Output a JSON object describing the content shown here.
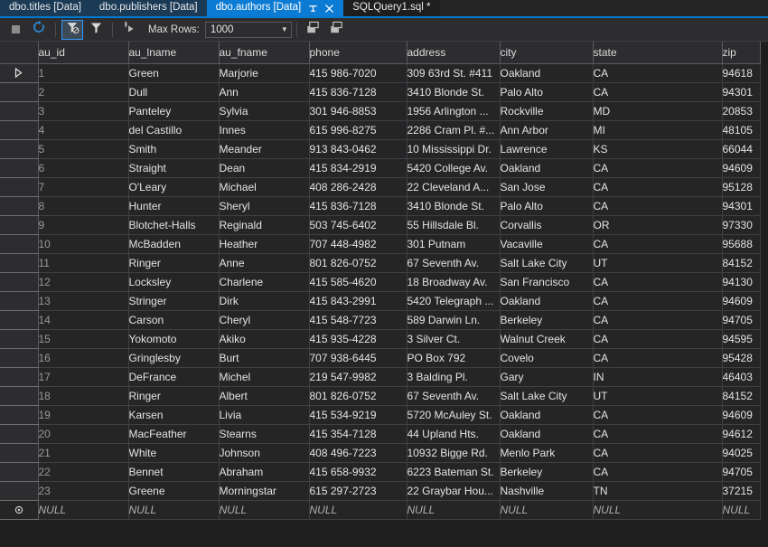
{
  "tabs": [
    {
      "label": "dbo.titles [Data]",
      "active": false,
      "style": "inactive"
    },
    {
      "label": "dbo.publishers [Data]",
      "active": false,
      "style": "inactive"
    },
    {
      "label": "dbo.authors [Data]",
      "active": true,
      "style": "active"
    },
    {
      "label": "SQLQuery1.sql *",
      "active": false,
      "style": "plain"
    }
  ],
  "tab_icons": {
    "pin": "pin-icon",
    "close": "close-icon"
  },
  "toolbar": {
    "stop": "stop-icon",
    "refresh": "refresh-icon",
    "filter_off": "filter-cancel-icon",
    "filter": "filter-icon",
    "sort": "sort-script-icon",
    "max_rows_label": "Max Rows:",
    "max_rows_value": "1000",
    "dropdown_arrow": "chevron-down-icon",
    "show_sql_pane": "show-sql-pane-icon",
    "show_results_pane": "show-results-pane-icon"
  },
  "colors": {
    "accent": "#0c7bd4",
    "tab_inactive": "#1b3a56",
    "toolbar_bg": "#2d2d30",
    "grid_bg": "#252526",
    "grid_line": "#3f3f46",
    "header_line": "#5b5b5e",
    "null_text": "#b0b0b0",
    "selected_border": "#3399ff"
  },
  "grid": {
    "columns": [
      "au_id",
      "au_lname",
      "au_fname",
      "phone",
      "address",
      "city",
      "state",
      "zip"
    ],
    "current_row_index": 0,
    "null_label": "NULL",
    "rows": [
      [
        "1",
        "Green",
        "Marjorie",
        "415 986-7020",
        "309 63rd St. #411",
        "Oakland",
        "CA",
        "94618"
      ],
      [
        "2",
        "Dull",
        "Ann",
        "415 836-7128",
        "3410 Blonde St.",
        "Palo Alto",
        "CA",
        "94301"
      ],
      [
        "3",
        "Panteley",
        "Sylvia",
        "301 946-8853",
        "1956 Arlington ...",
        "Rockville",
        "MD",
        "20853"
      ],
      [
        "4",
        "del Castillo",
        "Innes",
        "615 996-8275",
        "2286 Cram Pl. #...",
        "Ann Arbor",
        "MI",
        "48105"
      ],
      [
        "5",
        "Smith",
        "Meander",
        "913 843-0462",
        "10 Mississippi Dr.",
        "Lawrence",
        "KS",
        "66044"
      ],
      [
        "6",
        "Straight",
        "Dean",
        "415 834-2919",
        "5420 College Av.",
        "Oakland",
        "CA",
        "94609"
      ],
      [
        "7",
        "O'Leary",
        "Michael",
        "408 286-2428",
        "22 Cleveland A...",
        "San Jose",
        "CA",
        "95128"
      ],
      [
        "8",
        "Hunter",
        "Sheryl",
        "415 836-7128",
        "3410 Blonde St.",
        "Palo Alto",
        "CA",
        "94301"
      ],
      [
        "9",
        "Blotchet-Halls",
        "Reginald",
        "503 745-6402",
        "55 Hillsdale Bl.",
        "Corvallis",
        "OR",
        "97330"
      ],
      [
        "10",
        "McBadden",
        "Heather",
        "707 448-4982",
        "301 Putnam",
        "Vacaville",
        "CA",
        "95688"
      ],
      [
        "11",
        "Ringer",
        "Anne",
        "801 826-0752",
        "67 Seventh Av.",
        "Salt Lake City",
        "UT",
        "84152"
      ],
      [
        "12",
        "Locksley",
        "Charlene",
        "415 585-4620",
        "18 Broadway Av.",
        "San Francisco",
        "CA",
        "94130"
      ],
      [
        "13",
        "Stringer",
        "Dirk",
        "415 843-2991",
        "5420 Telegraph ...",
        "Oakland",
        "CA",
        "94609"
      ],
      [
        "14",
        "Carson",
        "Cheryl",
        "415 548-7723",
        "589 Darwin Ln.",
        "Berkeley",
        "CA",
        "94705"
      ],
      [
        "15",
        "Yokomoto",
        "Akiko",
        "415 935-4228",
        "3 Silver Ct.",
        "Walnut Creek",
        "CA",
        "94595"
      ],
      [
        "16",
        "Gringlesby",
        "Burt",
        "707 938-6445",
        "PO Box 792",
        "Covelo",
        "CA",
        "95428"
      ],
      [
        "17",
        "DeFrance",
        "Michel",
        "219 547-9982",
        "3 Balding Pl.",
        "Gary",
        "IN",
        "46403"
      ],
      [
        "18",
        "Ringer",
        "Albert",
        "801 826-0752",
        "67 Seventh Av.",
        "Salt Lake City",
        "UT",
        "84152"
      ],
      [
        "19",
        "Karsen",
        "Livia",
        "415 534-9219",
        "5720 McAuley St.",
        "Oakland",
        "CA",
        "94609"
      ],
      [
        "20",
        "MacFeather",
        "Stearns",
        "415 354-7128",
        "44 Upland Hts.",
        "Oakland",
        "CA",
        "94612"
      ],
      [
        "21",
        "White",
        "Johnson",
        "408 496-7223",
        "10932 Bigge Rd.",
        "Menlo Park",
        "CA",
        "94025"
      ],
      [
        "22",
        "Bennet",
        "Abraham",
        "415 658-9932",
        "6223 Bateman St.",
        "Berkeley",
        "CA",
        "94705"
      ],
      [
        "23",
        "Greene",
        "Morningstar",
        "615 297-2723",
        "22 Graybar Hou...",
        "Nashville",
        "TN",
        "37215"
      ]
    ]
  }
}
